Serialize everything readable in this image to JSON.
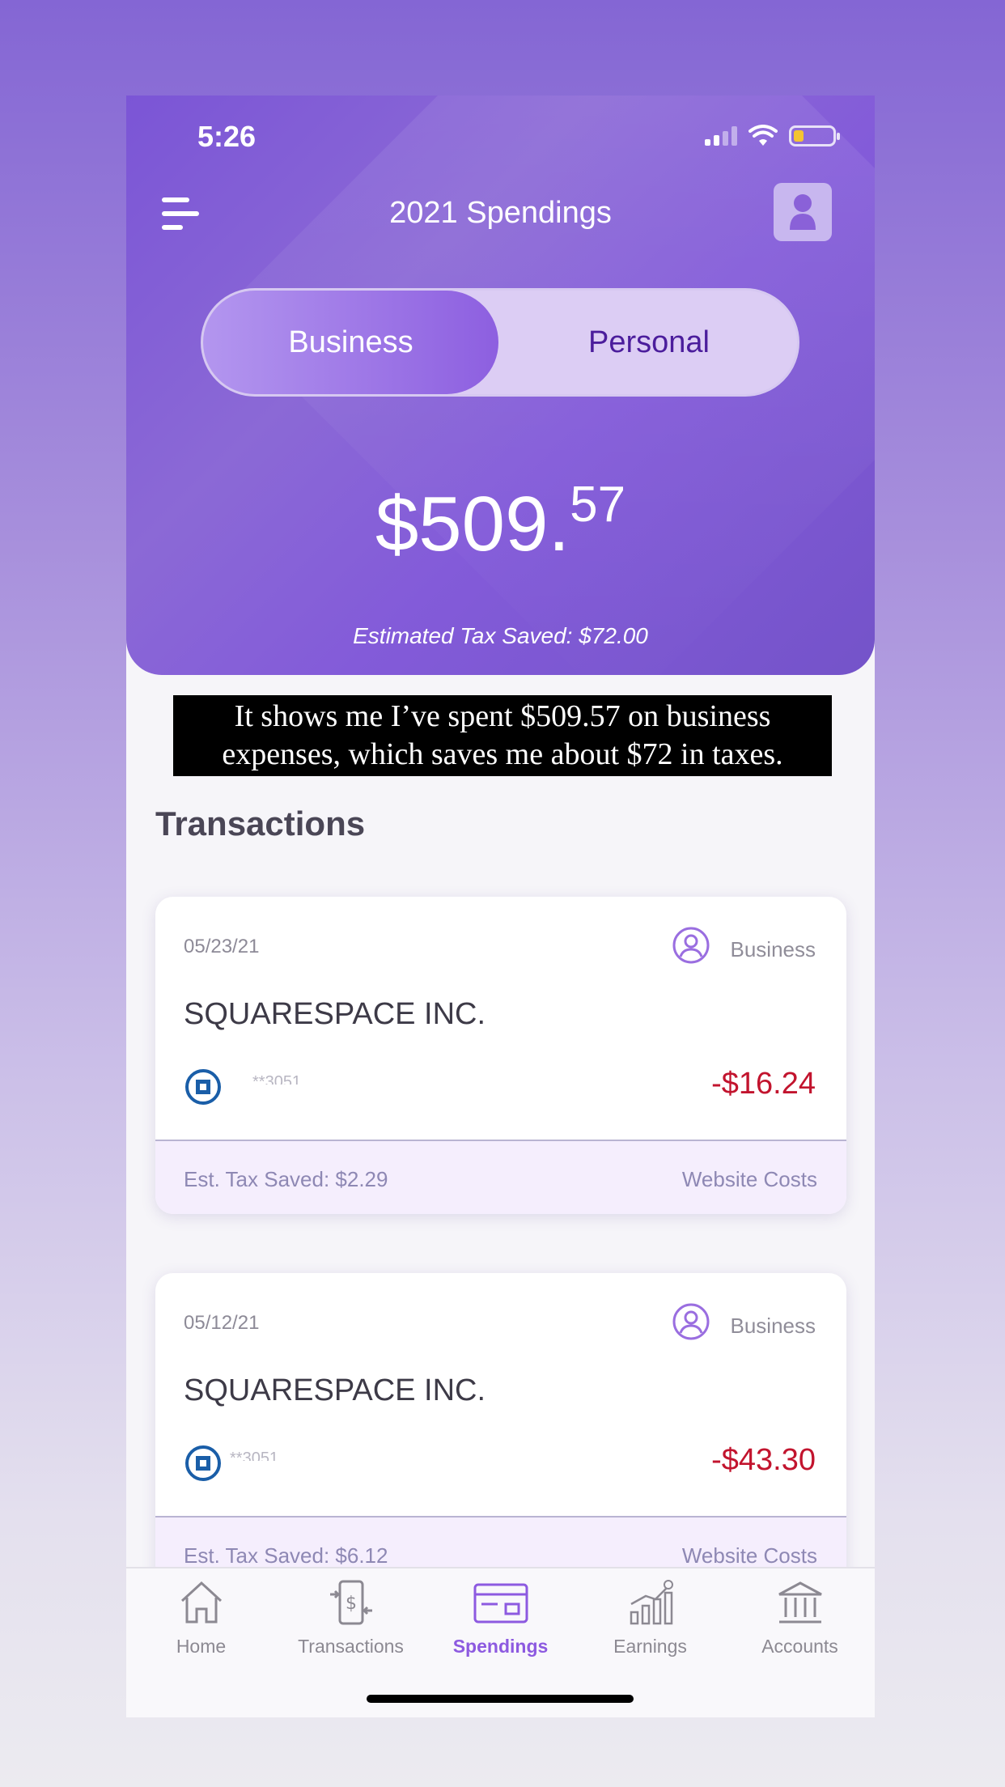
{
  "status_bar": {
    "time": "5:26"
  },
  "header": {
    "title": "2021 Spendings",
    "toggle": {
      "options": [
        "Business",
        "Personal"
      ],
      "selected": "Business"
    },
    "amount_main": "$509.",
    "amount_cents": "57",
    "estimated_tax": "Estimated Tax Saved: $72.00"
  },
  "caption": {
    "line1": "It shows me I’ve spent $509.57 on business",
    "line2": "expenses, which saves me about $72 in taxes."
  },
  "transactions": {
    "title": "Transactions",
    "items": [
      {
        "date": "05/23/21",
        "type": "Business",
        "merchant": "SQUARESPACE INC.",
        "account": "**3051",
        "amount": "-$16.24",
        "tax_saved": "Est. Tax Saved: $2.29",
        "category": "Website Costs"
      },
      {
        "date": "05/12/21",
        "type": "Business",
        "merchant": "SQUARESPACE INC.",
        "account": "**3051",
        "amount": "-$43.30",
        "tax_saved": "Est. Tax Saved: $6.12",
        "category": "Website Costs"
      }
    ]
  },
  "tabbar": {
    "tabs": [
      {
        "label": "Home",
        "icon": "home-icon"
      },
      {
        "label": "Transactions",
        "icon": "transactions-icon"
      },
      {
        "label": "Spendings",
        "icon": "card-icon"
      },
      {
        "label": "Earnings",
        "icon": "chart-icon"
      },
      {
        "label": "Accounts",
        "icon": "bank-icon"
      }
    ],
    "active": "Spendings"
  },
  "colors": {
    "accent": "#8d5ae0",
    "negative_amount": "#c2142e",
    "header_purple": "#7b55d6"
  }
}
